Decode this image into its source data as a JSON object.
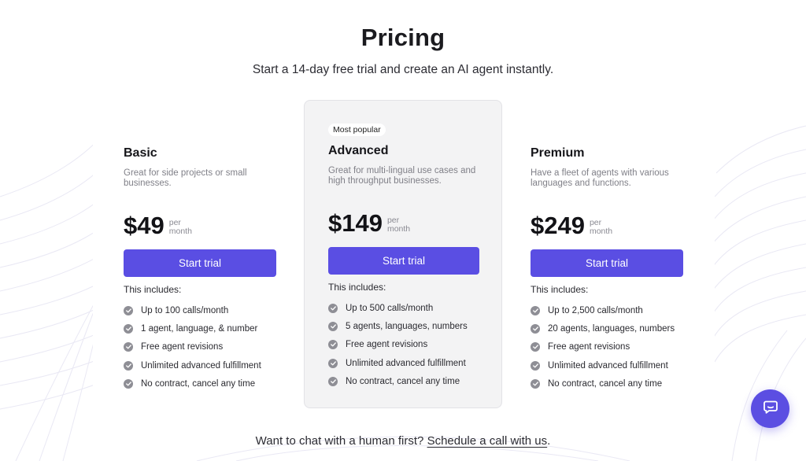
{
  "header": {
    "title": "Pricing",
    "subtitle": "Start a 14-day free trial and create an AI agent instantly."
  },
  "plans": [
    {
      "name": "Basic",
      "description": "Great for side projects or small businesses.",
      "price": "$49",
      "per": "per",
      "period": "month",
      "cta": "Start trial",
      "includes_label": "This includes:",
      "features": [
        "Up to 100 calls/month",
        "1 agent, language, & number",
        "Free agent revisions",
        "Unlimited advanced fulfillment",
        "No contract, cancel any time"
      ]
    },
    {
      "badge": "Most popular",
      "name": "Advanced",
      "description": "Great for multi-lingual use cases and high throughput businesses.",
      "price": "$149",
      "per": "per",
      "period": "month",
      "cta": "Start trial",
      "includes_label": "This includes:",
      "features": [
        "Up to 500 calls/month",
        "5 agents, languages, numbers",
        "Free agent revisions",
        "Unlimited advanced fulfillment",
        "No contract, cancel any time"
      ]
    },
    {
      "name": "Premium",
      "description": "Have a fleet of agents with various languages and functions.",
      "price": "$249",
      "per": "per",
      "period": "month",
      "cta": "Start trial",
      "includes_label": "This includes:",
      "features": [
        "Up to 2,500 calls/month",
        "20 agents, languages, numbers",
        "Free agent revisions",
        "Unlimited advanced fulfillment",
        "No contract, cancel any time"
      ]
    }
  ],
  "footer": {
    "text": "Want to chat with a human first?",
    "link_label": "Schedule a call with us",
    "suffix": "."
  },
  "chat_widget": {
    "icon": "chat-bubble-icon"
  },
  "colors": {
    "accent": "#5a4ee3",
    "featured_card_bg": "#f3f3f4",
    "check_icon": "#8e8e95"
  }
}
